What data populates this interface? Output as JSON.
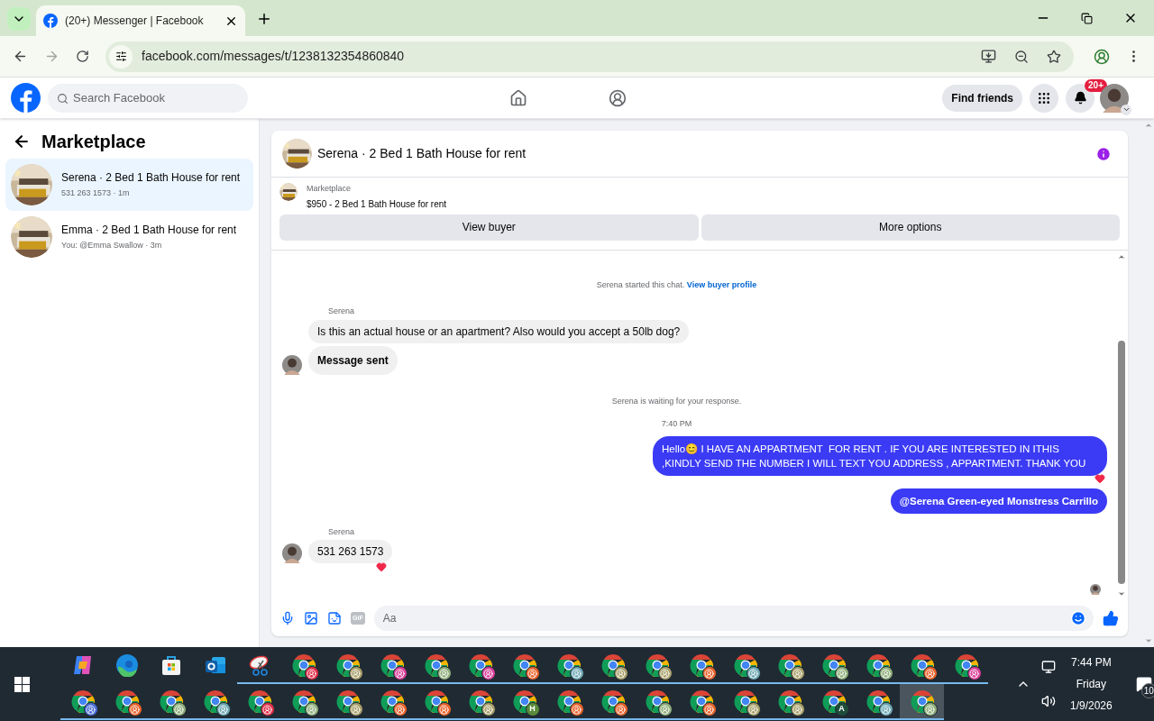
{
  "browser": {
    "tab": {
      "title": "(20+) Messenger | Facebook",
      "selected": true
    },
    "url": "facebook.com/messages/t/1238132354860840"
  },
  "facebook": {
    "search": {
      "placeholder": "Search Facebook"
    },
    "find_friends": "Find friends",
    "notification_badge": "20+"
  },
  "sidebar": {
    "title": "Marketplace",
    "items": [
      {
        "title": "Serena · 2 Bed 1 Bath House for rent",
        "subtitle": "531 263 1573 · 1m",
        "selected": true
      },
      {
        "title": "Emma · 2 Bed 1 Bath House for rent",
        "subtitle": "You: @Emma Swallow · 3m",
        "selected": false
      }
    ]
  },
  "chat": {
    "title": "Serena · 2 Bed 1 Bath House for rent",
    "listing": {
      "label": "Marketplace",
      "description": "$950 - 2 Bed 1 Bath House for rent"
    },
    "buttons": [
      "View buyer",
      "More options"
    ],
    "messages": [
      {
        "kind": "system",
        "text": "Serena started this chat.",
        "link": "View buyer profile"
      },
      {
        "kind": "incoming",
        "sender": "Serena",
        "bubbles": [
          {
            "text": "Is this an actual house or an apartment? Also would you accept a 50lb dog?",
            "bold": false,
            "reacted": false
          },
          {
            "text": "Message sent",
            "bold": true,
            "reacted": false
          }
        ]
      },
      {
        "kind": "system",
        "text": "Serena is waiting for your response."
      },
      {
        "kind": "time",
        "text": "7:40 PM"
      },
      {
        "kind": "outgoing",
        "text": "Hello😊 I HAVE AN APPARTMENT  FOR RENT . IF YOU ARE INTERESTED IN ITHIS ,KINDLY SEND THE NUMBER I WILL TEXT YOU ADDRESS , APPARTMENT. THANK YOU",
        "bold": false,
        "reacted": true
      },
      {
        "kind": "outgoing",
        "text": "@Serena Green-eyed Monstress Carrillo",
        "bold": true,
        "reacted": false
      },
      {
        "kind": "incoming",
        "sender": "Serena",
        "bubbles": [
          {
            "text": "531 263 1573",
            "bold": false,
            "reacted": true
          }
        ]
      }
    ],
    "composer": {
      "placeholder": "Aa",
      "gif": "GIF"
    }
  },
  "taskbar": {
    "rows": [
      [
        {
          "kind": "copilot",
          "running": false
        },
        {
          "kind": "edge",
          "running": false
        },
        {
          "kind": "store",
          "running": false
        },
        {
          "kind": "outlook",
          "running": false
        },
        {
          "kind": "snipping",
          "running": true
        },
        {
          "kind": "chrome",
          "color": "#e0304a",
          "running": true
        },
        {
          "kind": "chrome",
          "color": "#a89f6a",
          "running": true
        },
        {
          "kind": "chrome",
          "color": "#d9409a",
          "running": true
        },
        {
          "kind": "chrome",
          "color": "#8fae7a",
          "running": true
        },
        {
          "kind": "chrome",
          "color": "#d9409a",
          "running": true
        },
        {
          "kind": "chrome",
          "color": "#e8632c",
          "running": true
        },
        {
          "kind": "chrome",
          "color": "#6fa9b5",
          "running": true
        },
        {
          "kind": "chrome",
          "color": "#a89f6a",
          "running": true
        },
        {
          "kind": "chrome",
          "color": "#a89f6a",
          "running": true
        },
        {
          "kind": "chrome",
          "color": "#e8632c",
          "running": true
        },
        {
          "kind": "chrome",
          "color": "#6fa9b5",
          "running": true
        },
        {
          "kind": "chrome",
          "color": "#a89f6a",
          "running": true
        },
        {
          "kind": "chrome",
          "color": "#8fae7a",
          "running": true
        },
        {
          "kind": "chrome",
          "color": "#8fae7a",
          "running": true
        },
        {
          "kind": "chrome",
          "color": "#e8632c",
          "running": true
        },
        {
          "kind": "chrome",
          "color": "#d9409a",
          "running": true
        }
      ],
      [
        {
          "kind": "chrome",
          "color": "#4a6bd6",
          "running": true
        },
        {
          "kind": "chrome",
          "color": "#e8632c",
          "running": true
        },
        {
          "kind": "chrome",
          "color": "#8fae7a",
          "running": true
        },
        {
          "kind": "chrome",
          "color": "#6fa9b5",
          "running": true
        },
        {
          "kind": "chrome",
          "color": "#e0304a",
          "running": true
        },
        {
          "kind": "chrome",
          "color": "#8fae7a",
          "running": true
        },
        {
          "kind": "chrome",
          "color": "#a89f6a",
          "running": true
        },
        {
          "kind": "chrome",
          "color": "#e8632c",
          "running": true
        },
        {
          "kind": "chrome",
          "color": "#e8632c",
          "running": true
        },
        {
          "kind": "chrome",
          "color": "#a89f6a",
          "running": true
        },
        {
          "kind": "chrome",
          "color": "#5a8a3a",
          "letter": "H",
          "running": true
        },
        {
          "kind": "chrome",
          "color": "#e8632c",
          "running": true
        },
        {
          "kind": "chrome",
          "color": "#e8632c",
          "running": true
        },
        {
          "kind": "chrome",
          "color": "#8fae7a",
          "running": true
        },
        {
          "kind": "chrome",
          "color": "#e8632c",
          "running": true
        },
        {
          "kind": "chrome",
          "color": "#a89f6a",
          "running": true
        },
        {
          "kind": "chrome",
          "color": "#a89f6a",
          "running": true
        },
        {
          "kind": "chrome",
          "color": "#1e4d3a",
          "letter": "A",
          "running": true
        },
        {
          "kind": "chrome",
          "color": "#6fa9b5",
          "running": true
        },
        {
          "kind": "chrome",
          "color": "#8fae7a",
          "running": true,
          "selected": true
        }
      ]
    ],
    "clock": {
      "time": "7:44 PM",
      "day": "Friday",
      "date": "1/9/2026"
    },
    "notification_count": "10"
  }
}
